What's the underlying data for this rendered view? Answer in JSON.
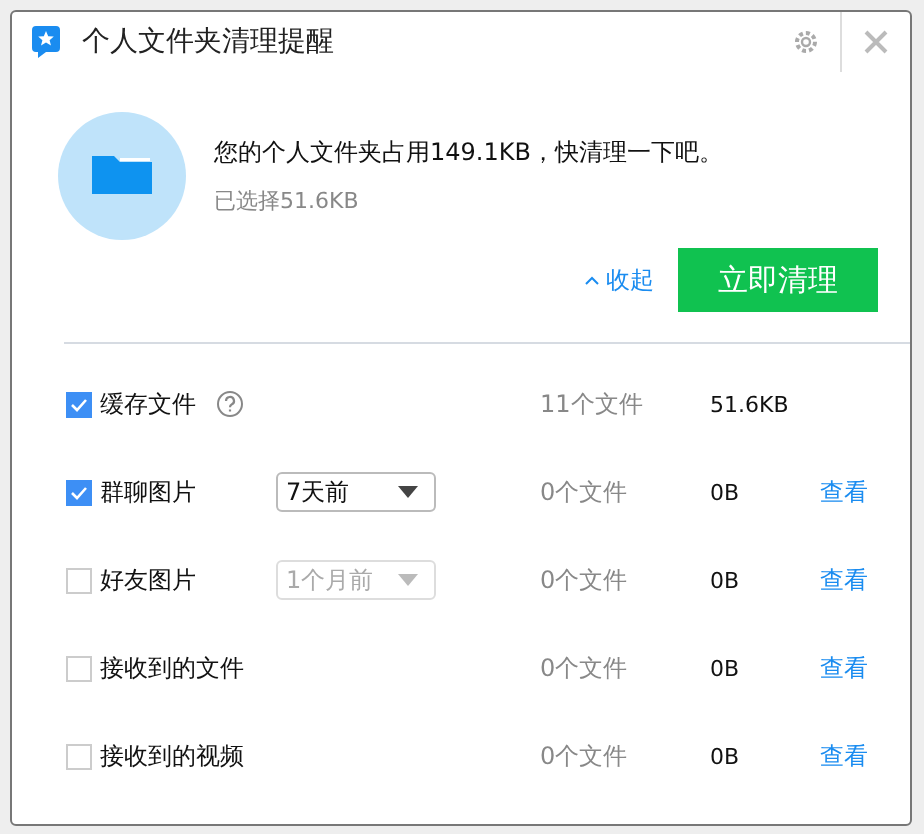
{
  "window": {
    "title": "个人文件夹清理提醒"
  },
  "summary": {
    "message": "您的个人文件夹占用149.1KB，快清理一下吧。",
    "selected": "已选择51.6KB",
    "collapse": "收起",
    "clean_button": "立即清理"
  },
  "items": [
    {
      "kind": "help",
      "label": "缓存文件",
      "checked": true,
      "count": "11个文件",
      "size": "51.6KB"
    },
    {
      "kind": "dropdown",
      "label": "群聊图片",
      "checked": true,
      "period": "7天前",
      "disabled": false,
      "count": "0个文件",
      "size": "0B",
      "view": "查看"
    },
    {
      "kind": "dropdown",
      "label": "好友图片",
      "checked": false,
      "period": "1个月前",
      "disabled": true,
      "count": "0个文件",
      "size": "0B",
      "view": "查看"
    },
    {
      "kind": "plain",
      "label": "接收到的文件",
      "checked": false,
      "count": "0个文件",
      "size": "0B",
      "view": "查看"
    },
    {
      "kind": "plain",
      "label": "接收到的视频",
      "checked": false,
      "count": "0个文件",
      "size": "0B",
      "view": "查看"
    }
  ]
}
